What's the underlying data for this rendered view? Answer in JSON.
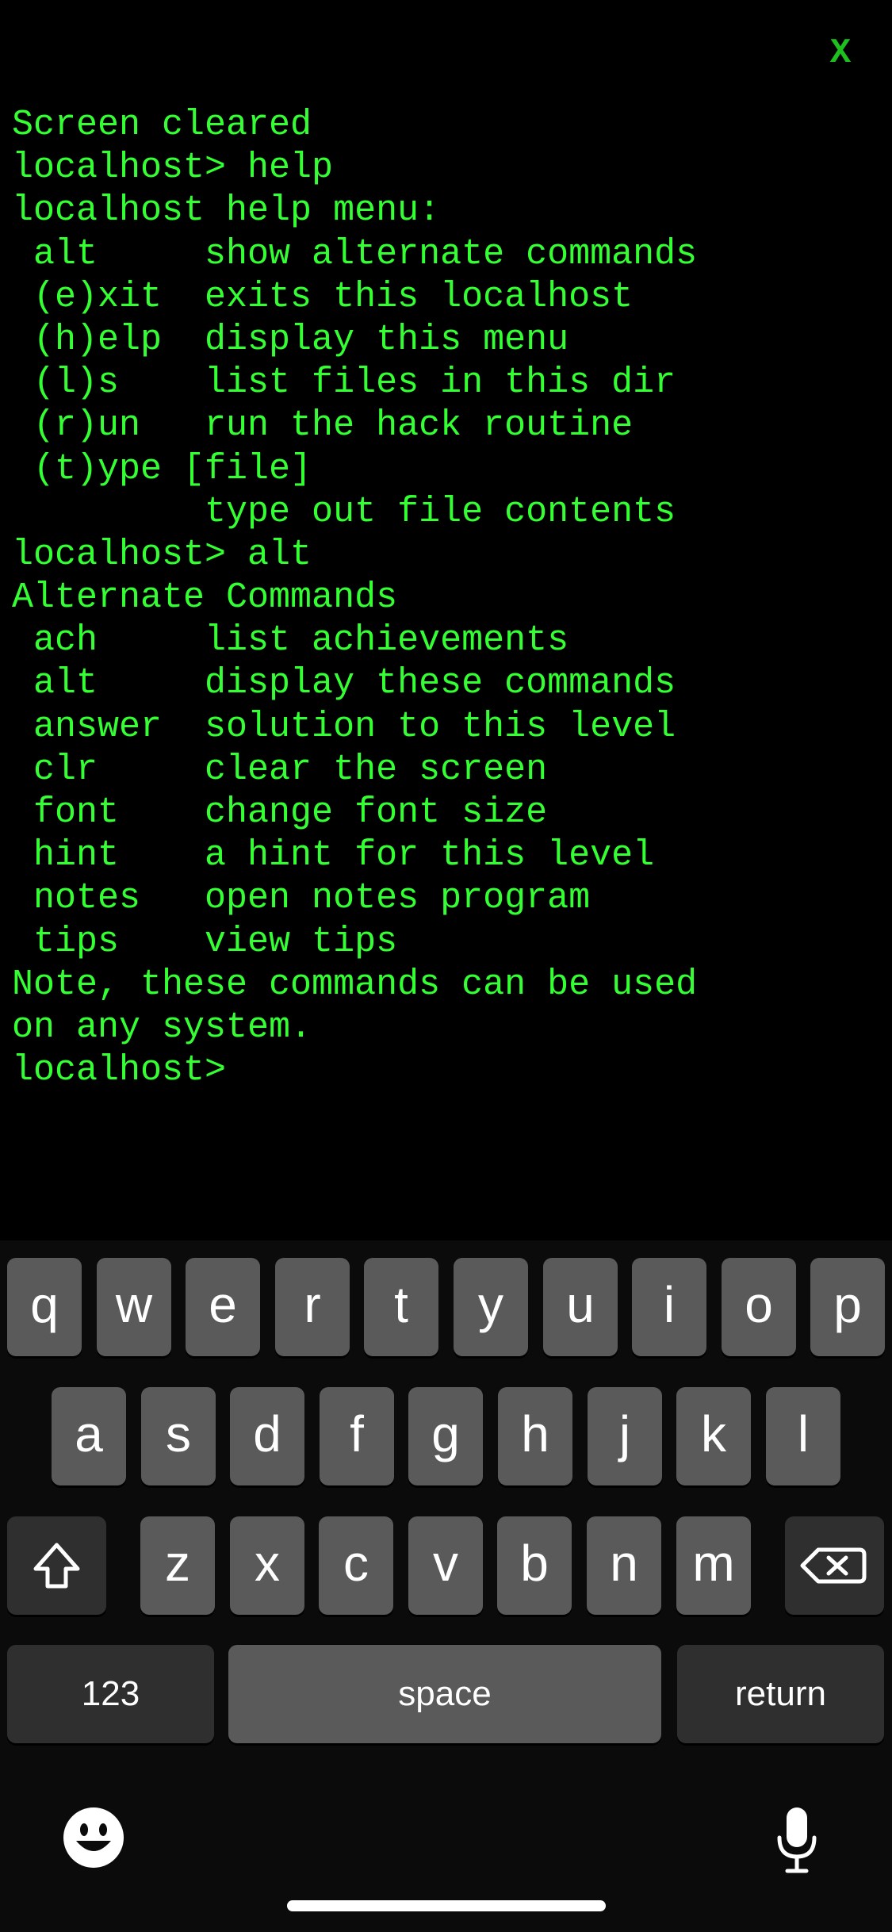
{
  "close_label": "X",
  "terminal": {
    "lines": [
      "Screen cleared",
      "localhost> help",
      "localhost help menu:",
      " alt     show alternate commands",
      " (e)xit  exits this localhost",
      " (h)elp  display this menu",
      " (l)s    list files in this dir",
      " (r)un   run the hack routine",
      " (t)ype [file]",
      "         type out file contents",
      "localhost> alt",
      "Alternate Commands",
      " ach     list achievements",
      " alt     display these commands",
      " answer  solution to this level",
      " clr     clear the screen",
      " font    change font size",
      " hint    a hint for this level",
      " notes   open notes program",
      " tips    view tips",
      "Note, these commands can be used",
      "on any system.",
      "localhost>"
    ]
  },
  "keyboard": {
    "row1": [
      "q",
      "w",
      "e",
      "r",
      "t",
      "y",
      "u",
      "i",
      "o",
      "p"
    ],
    "row2": [
      "a",
      "s",
      "d",
      "f",
      "g",
      "h",
      "j",
      "k",
      "l"
    ],
    "row3": [
      "z",
      "x",
      "c",
      "v",
      "b",
      "n",
      "m"
    ],
    "shift_icon": "shift-arrow-icon",
    "delete_icon": "backspace-icon",
    "numbers_label": "123",
    "space_label": "space",
    "return_label": "return",
    "emoji_icon": "emoji-icon",
    "mic_icon": "microphone-icon"
  },
  "colors": {
    "terminal_text": "#33ff33",
    "close_text": "#1fbf1f",
    "background": "#000000",
    "key": "#5a5a5a",
    "key_dark": "#2f2f2f"
  }
}
